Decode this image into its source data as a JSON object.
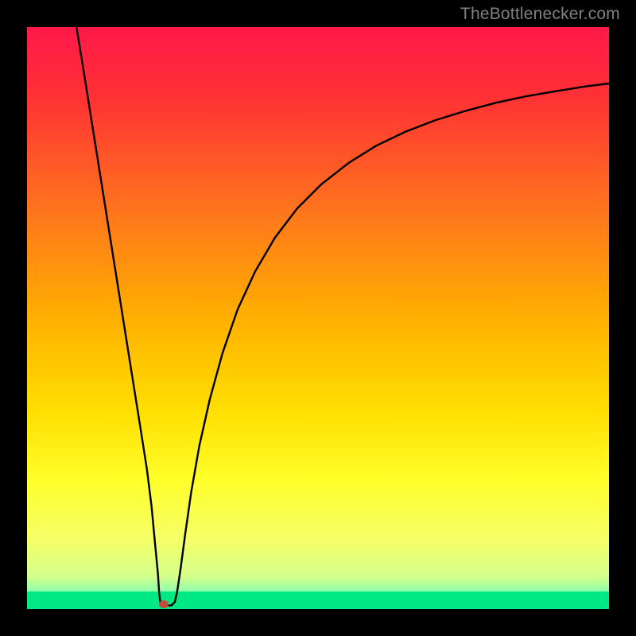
{
  "watermark": "TheBottlenecker.com",
  "chart_data": {
    "type": "line",
    "title": "",
    "xlabel": "",
    "ylabel": "",
    "xlim": [
      0,
      1
    ],
    "ylim": [
      0,
      1
    ],
    "background_gradient": {
      "stops": [
        {
          "offset": 0.0,
          "color": "#ff184a"
        },
        {
          "offset": 0.12,
          "color": "#ff3134"
        },
        {
          "offset": 0.3,
          "color": "#ff6f1f"
        },
        {
          "offset": 0.5,
          "color": "#ffb000"
        },
        {
          "offset": 0.66,
          "color": "#ffdf00"
        },
        {
          "offset": 0.78,
          "color": "#ffff2a"
        },
        {
          "offset": 0.88,
          "color": "#f5ff66"
        },
        {
          "offset": 0.945,
          "color": "#d4ff8c"
        },
        {
          "offset": 0.975,
          "color": "#7dffb0"
        },
        {
          "offset": 1.0,
          "color": "#00e884"
        }
      ]
    },
    "green_band": {
      "y": 0.03
    },
    "marker": {
      "x": 0.235,
      "y": 0.008,
      "color": "#c44b3f"
    },
    "series": [
      {
        "name": "curve",
        "type": "line",
        "color": "#000000",
        "points": [
          {
            "x": 0.085,
            "y": 1.0
          },
          {
            "x": 0.098,
            "y": 0.92
          },
          {
            "x": 0.112,
            "y": 0.832
          },
          {
            "x": 0.126,
            "y": 0.744
          },
          {
            "x": 0.14,
            "y": 0.656
          },
          {
            "x": 0.154,
            "y": 0.568
          },
          {
            "x": 0.168,
            "y": 0.48
          },
          {
            "x": 0.182,
            "y": 0.392
          },
          {
            "x": 0.196,
            "y": 0.304
          },
          {
            "x": 0.206,
            "y": 0.24
          },
          {
            "x": 0.214,
            "y": 0.176
          },
          {
            "x": 0.22,
            "y": 0.112
          },
          {
            "x": 0.225,
            "y": 0.06
          },
          {
            "x": 0.227,
            "y": 0.028
          },
          {
            "x": 0.229,
            "y": 0.012
          },
          {
            "x": 0.232,
            "y": 0.006
          },
          {
            "x": 0.24,
            "y": 0.006
          },
          {
            "x": 0.248,
            "y": 0.006
          },
          {
            "x": 0.254,
            "y": 0.012
          },
          {
            "x": 0.258,
            "y": 0.03
          },
          {
            "x": 0.264,
            "y": 0.07
          },
          {
            "x": 0.272,
            "y": 0.13
          },
          {
            "x": 0.282,
            "y": 0.2
          },
          {
            "x": 0.296,
            "y": 0.28
          },
          {
            "x": 0.314,
            "y": 0.36
          },
          {
            "x": 0.336,
            "y": 0.44
          },
          {
            "x": 0.362,
            "y": 0.515
          },
          {
            "x": 0.392,
            "y": 0.58
          },
          {
            "x": 0.426,
            "y": 0.638
          },
          {
            "x": 0.464,
            "y": 0.688
          },
          {
            "x": 0.506,
            "y": 0.73
          },
          {
            "x": 0.552,
            "y": 0.766
          },
          {
            "x": 0.6,
            "y": 0.796
          },
          {
            "x": 0.65,
            "y": 0.82
          },
          {
            "x": 0.702,
            "y": 0.84
          },
          {
            "x": 0.754,
            "y": 0.856
          },
          {
            "x": 0.806,
            "y": 0.87
          },
          {
            "x": 0.858,
            "y": 0.881
          },
          {
            "x": 0.91,
            "y": 0.89
          },
          {
            "x": 0.96,
            "y": 0.898
          },
          {
            "x": 1.0,
            "y": 0.903
          }
        ]
      }
    ]
  }
}
